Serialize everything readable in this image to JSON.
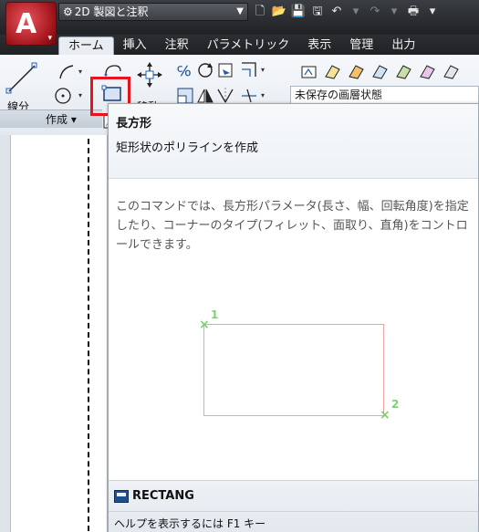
{
  "title_bar": {
    "workspace": "2D 製図と注釈",
    "app_menu_letter": "A"
  },
  "tabs": [
    "ホーム",
    "挿入",
    "注釈",
    "パラメトリック",
    "表示",
    "管理",
    "出力"
  ],
  "ribbon": {
    "line_label": "線分",
    "move_label": "移動",
    "layer_state": "未保存の画層状態",
    "panel_create": "作成 ▾"
  },
  "tooltip": {
    "title": "長方形",
    "subtitle": "矩形状のポリラインを作成",
    "description": "このコマンドでは、長方形パラメータ(長さ、幅、回転角度)を指定したり、コーナーのタイプ(フィレット、面取り、直角)をコントロールできます。",
    "point1": "1",
    "point2": "2",
    "command": "RECTANG",
    "help": "ヘルプを表示するには F1 キー"
  },
  "colors": {
    "highlight": "#e8141c",
    "rectangle": "#f2a0a5",
    "point_marker": "#7dd076"
  }
}
